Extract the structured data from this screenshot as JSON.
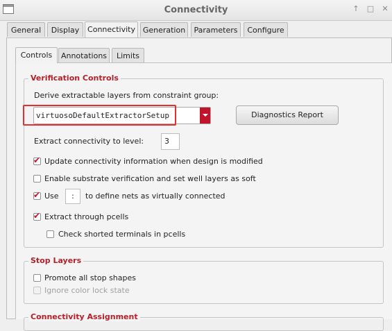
{
  "window": {
    "title": "Connectivity",
    "controls": {
      "restore": "↑",
      "maximize": "□",
      "close": "✕"
    }
  },
  "main_tabs": [
    {
      "label": "General"
    },
    {
      "label": "Display"
    },
    {
      "label": "Connectivity"
    },
    {
      "label": "Generation"
    },
    {
      "label": "Parameters"
    },
    {
      "label": "Configure"
    }
  ],
  "sub_tabs": [
    {
      "label": "Controls"
    },
    {
      "label": "Annotations"
    },
    {
      "label": "Limits"
    }
  ],
  "verification": {
    "title": "Verification Controls",
    "derive_label": "Derive extractable layers from constraint group:",
    "constraint_group_value": "virtuosoDefaultExtractorSetup",
    "diagnostics_label": "Diagnostics Report",
    "extract_level_label": "Extract connectivity to level:",
    "extract_level_value": "3",
    "update_label": "Update connectivity information when design is modified",
    "update_checked": true,
    "substrate_label": "Enable substrate verification and set well layers as soft",
    "substrate_checked": false,
    "use_label": "Use",
    "use_checked": true,
    "use_value": ":",
    "use_suffix": "to define nets as virtually connected",
    "pcells_label": "Extract through pcells",
    "pcells_checked": true,
    "shorted_label": "Check shorted terminals in pcells",
    "shorted_checked": false
  },
  "stop_layers": {
    "title": "Stop Layers",
    "promote_label": "Promote all stop shapes",
    "promote_checked": false,
    "ignore_label": "Ignore color lock state",
    "ignore_checked": false
  },
  "assignment": {
    "title": "Connectivity Assignment"
  },
  "colors": {
    "accent": "#c2132d",
    "group_title": "#b2202a",
    "highlight": "#e0312e"
  }
}
